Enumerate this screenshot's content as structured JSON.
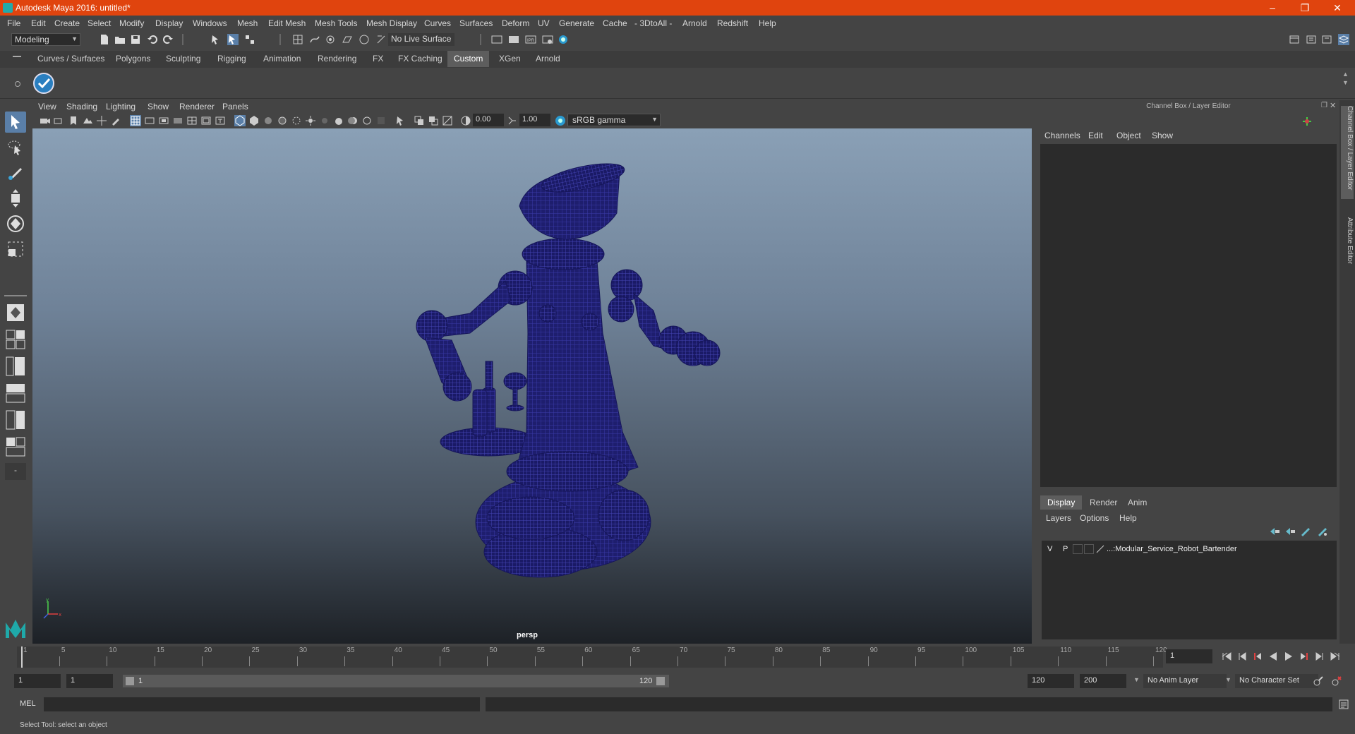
{
  "window": {
    "title": "Autodesk Maya 2016: untitled*"
  },
  "menubar": [
    "File",
    "Edit",
    "Create",
    "Select",
    "Modify",
    "Display",
    "Windows",
    "Mesh",
    "Edit Mesh",
    "Mesh Tools",
    "Mesh Display",
    "Curves",
    "Surfaces",
    "Deform",
    "UV",
    "Generate",
    "Cache",
    "- 3DtoAll -",
    "Arnold",
    "Redshift",
    "Help"
  ],
  "statusline": {
    "menuset": "Modeling",
    "live_surface": "No Live Surface"
  },
  "shelf": {
    "tabs": [
      "Curves / Surfaces",
      "Polygons",
      "Sculpting",
      "Rigging",
      "Animation",
      "Rendering",
      "FX",
      "FX Caching",
      "Custom",
      "XGen",
      "Arnold"
    ],
    "active": "Custom"
  },
  "viewport": {
    "menu": [
      "View",
      "Shading",
      "Lighting",
      "Show",
      "Renderer",
      "Panels"
    ],
    "exposure": "0.00",
    "gamma": "1.00",
    "colorspace": "sRGB gamma",
    "camera": "persp"
  },
  "channelbox": {
    "title": "Channel Box / Layer Editor",
    "menu": [
      "Channels",
      "Edit",
      "Object",
      "Show"
    ],
    "layer_tabs": [
      "Display",
      "Render",
      "Anim"
    ],
    "layer_tab_active": "Display",
    "layer_menu": [
      "Layers",
      "Options",
      "Help"
    ],
    "layers": [
      {
        "v": "V",
        "p": "P",
        "name": "...:Modular_Service_Robot_Bartender"
      }
    ]
  },
  "side_tabs": [
    "Channel Box / Layer Editor",
    "Attribute Editor"
  ],
  "timeline": {
    "ticks": [
      "1",
      "5",
      "10",
      "15",
      "20",
      "25",
      "30",
      "35",
      "40",
      "45",
      "50",
      "55",
      "60",
      "65",
      "70",
      "75",
      "80",
      "85",
      "90",
      "95",
      "100",
      "105",
      "110",
      "115",
      "120"
    ],
    "current_frame": "1"
  },
  "range": {
    "start": "1",
    "playback_start": "1",
    "slider_start": "1",
    "slider_end": "120",
    "playback_end": "120",
    "end": "200",
    "anim_layer": "No Anim Layer",
    "character_set": "No Character Set"
  },
  "cmdline": {
    "label": "MEL"
  },
  "helpline": {
    "text": "Select Tool: select an object"
  },
  "colors": {
    "titlebar": "#e0440e",
    "wireframe": "#1a1a7a",
    "active_tab": "#5d5d5d"
  }
}
